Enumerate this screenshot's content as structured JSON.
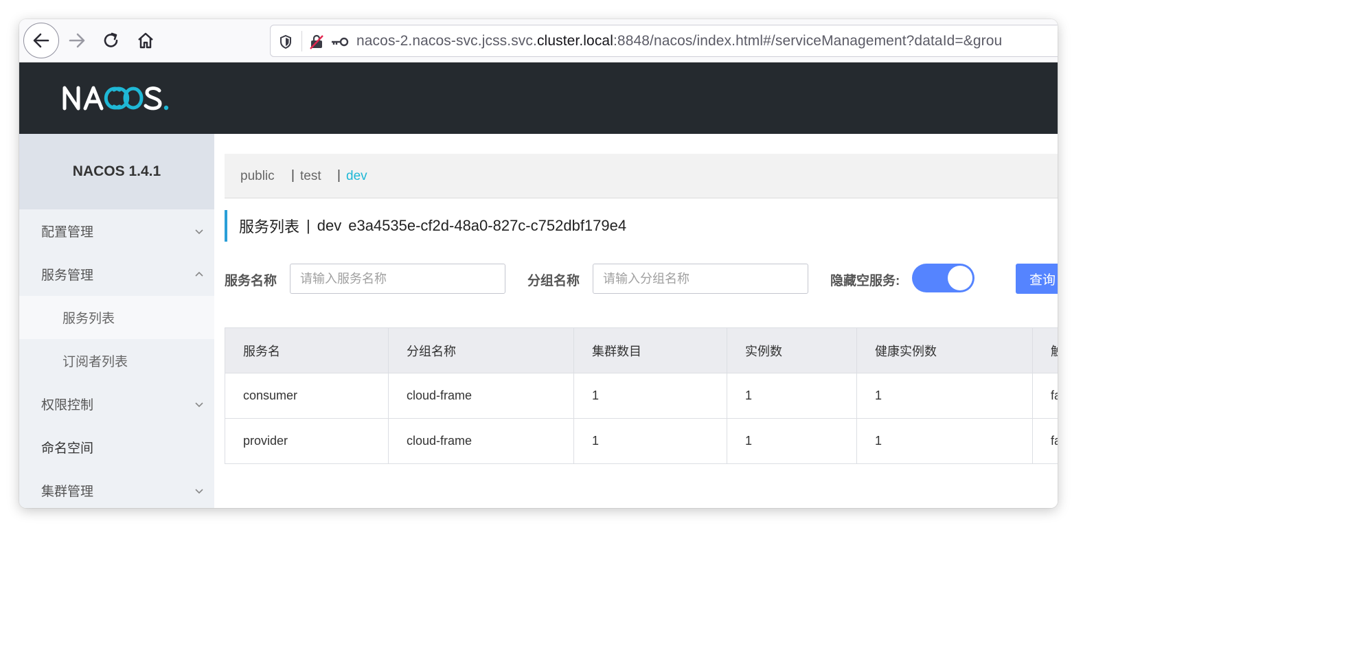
{
  "browser": {
    "url_prefix": "nacos-2.nacos-svc.jcss.svc.",
    "url_host": "cluster.local",
    "url_suffix": ":8848/nacos/index.html#/serviceManagement?dataId=&grou"
  },
  "header": {
    "logo_text": "NACOS."
  },
  "sidebar": {
    "title": "NACOS 1.4.1",
    "items": [
      {
        "label": "配置管理"
      },
      {
        "label": "服务管理"
      },
      {
        "label": "服务列表"
      },
      {
        "label": "订阅者列表"
      },
      {
        "label": "权限控制"
      },
      {
        "label": "命名空间"
      },
      {
        "label": "集群管理"
      }
    ]
  },
  "namespaces": [
    {
      "label": "public"
    },
    {
      "label": "test"
    },
    {
      "label": "dev"
    }
  ],
  "page": {
    "title": "服务列表",
    "separator": "|",
    "namespace": "dev",
    "namespace_id": "e3a4535e-cf2d-48a0-827c-c752dbf179e4"
  },
  "filters": {
    "service_label": "服务名称",
    "service_placeholder": "请输入服务名称",
    "group_label": "分组名称",
    "group_placeholder": "请输入分组名称",
    "hide_empty_label": "隐藏空服务:",
    "query_label": "查询"
  },
  "table": {
    "headers": [
      "服务名",
      "分组名称",
      "集群数目",
      "实例数",
      "健康实例数",
      "触"
    ],
    "rows": [
      [
        "consumer",
        "cloud-frame",
        "1",
        "1",
        "1",
        "fa"
      ],
      [
        "provider",
        "cloud-frame",
        "1",
        "1",
        "1",
        "fa"
      ]
    ]
  },
  "colors": {
    "accent": "#5584ff",
    "namespace_active": "#1fb8d6",
    "header_bg": "#252a2f",
    "logo_cyan": "#1fb8d6"
  }
}
